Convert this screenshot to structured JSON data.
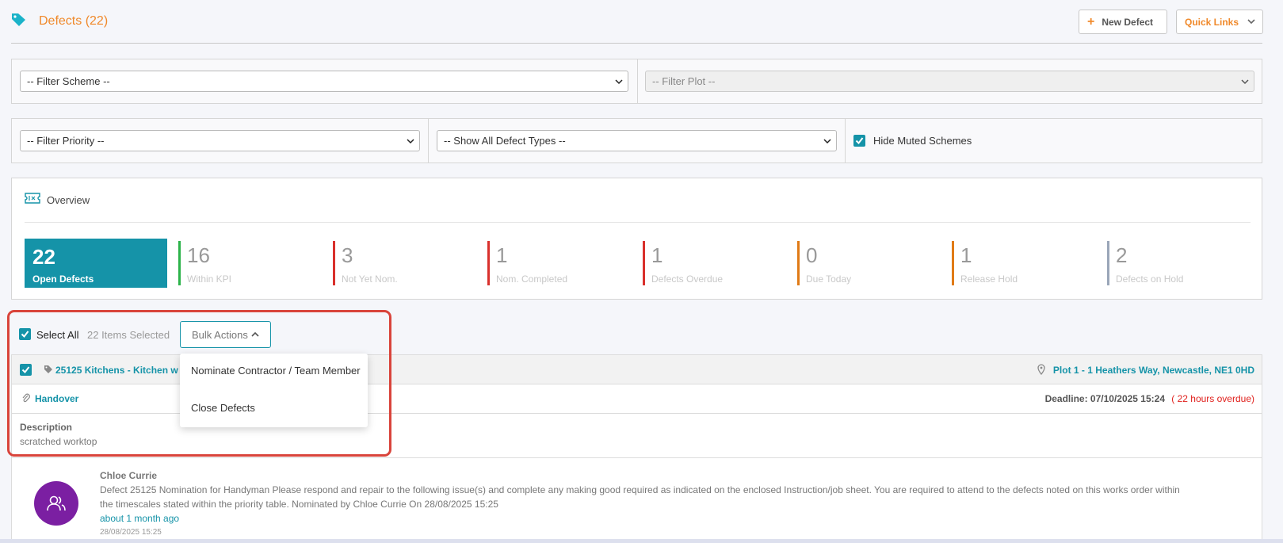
{
  "header": {
    "title": "Defects (22)",
    "new_defect_label": "New Defect",
    "quick_links_label": "Quick Links"
  },
  "filters": {
    "scheme": "-- Filter Scheme --",
    "plot": "-- Filter Plot --",
    "priority": "-- Filter Priority --",
    "defect_types": "-- Show All Defect Types --",
    "hide_muted_label": "Hide Muted Schemes",
    "hide_muted_checked": true
  },
  "overview": {
    "title": "Overview",
    "main": {
      "value": "22",
      "label": "Open Defects"
    },
    "stats": [
      {
        "value": "16",
        "label": "Within KPI",
        "color": "#2cb34a"
      },
      {
        "value": "3",
        "label": "Not Yet Nom.",
        "color": "#d9302c"
      },
      {
        "value": "1",
        "label": "Nom. Completed",
        "color": "#d9302c"
      },
      {
        "value": "1",
        "label": "Defects Overdue",
        "color": "#d9302c"
      },
      {
        "value": "0",
        "label": "Due Today",
        "color": "#e07b16"
      },
      {
        "value": "1",
        "label": "Release Hold",
        "color": "#e07b16"
      },
      {
        "value": "2",
        "label": "Defects on Hold",
        "color": "#9aa6b8"
      }
    ]
  },
  "selection": {
    "select_all_label": "Select All",
    "selected_count": "22 Items Selected",
    "bulk_actions_label": "Bulk Actions",
    "menu_items": [
      "Nominate Contractor / Team Member",
      "Close Defects"
    ]
  },
  "defect": {
    "title": "25125 Kitchens - Kitchen w",
    "location": "Plot 1 - 1 Heathers Way, Newcastle, NE1 0HD",
    "stage": "Handover",
    "deadline": "Deadline: 07/10/2025 15:24",
    "overdue": "( 22 hours overdue)",
    "description_label": "Description",
    "description": "scratched worktop"
  },
  "comment": {
    "author": "Chloe Currie",
    "text_line1": "Defect 25125 Nomination for Handyman Please respond and repair to the following issue(s) and complete any making good required as indicated on the enclosed Instruction/job sheet. You are required to attend to the defects noted on this works order within",
    "text_line2": "the timescales stated within the priority table. Nominated by Chloe Currie On 28/08/2025 15:25",
    "relative_time": "about 1 month ago",
    "timestamp": "28/08/2025 15:25"
  },
  "colors": {
    "accent": "#1593a8",
    "orange": "#f0892a",
    "highlight": "#d9443b",
    "avatar": "#7b1fa2"
  }
}
